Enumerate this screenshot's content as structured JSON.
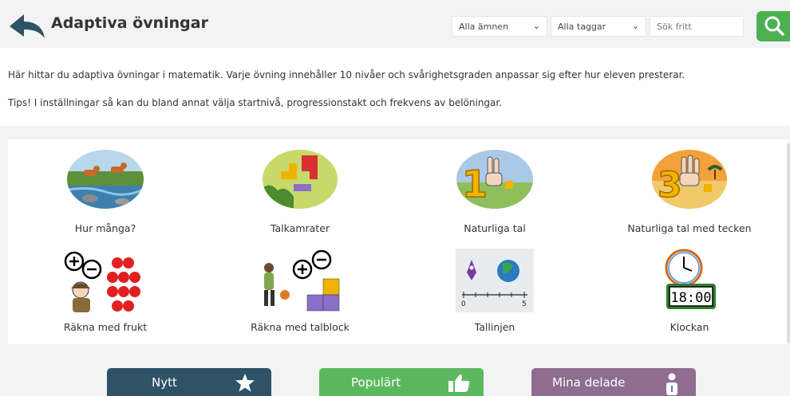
{
  "header": {
    "title": "Adaptiva övningar",
    "subject_filter": "Alla ämnen",
    "tag_filter": "Alla taggar",
    "search_placeholder": "Sök fritt"
  },
  "info": {
    "line1": "Här hittar du adaptiva övningar i matematik. Varje övning innehåller 10 nivåer och svårighetsgraden anpassar sig efter hur eleven presterar.",
    "line2": "Tips! I inställningar så kan du bland annat välja startnivå, progressionstakt och frekvens av belöningar."
  },
  "exercises": [
    {
      "label": "Hur många?"
    },
    {
      "label": "Talkamrater"
    },
    {
      "label": "Naturliga tal"
    },
    {
      "label": "Naturliga tal med tecken"
    },
    {
      "label": "Räkna med frukt"
    },
    {
      "label": "Räkna med talblock"
    },
    {
      "label": "Tallinjen"
    },
    {
      "label": "Klockan"
    }
  ],
  "bottom_tabs": [
    {
      "label": "Nytt",
      "icon": "star-icon",
      "color": "#2e5266"
    },
    {
      "label": "Populärt",
      "icon": "thumbs-up-icon",
      "color": "#5cb85c"
    },
    {
      "label": "Mina delade",
      "icon": "person-icon",
      "color": "#8e6d91"
    }
  ],
  "tallinjen_numbers": {
    "start": "0",
    "end": "5"
  },
  "klockan_time": "18:00"
}
